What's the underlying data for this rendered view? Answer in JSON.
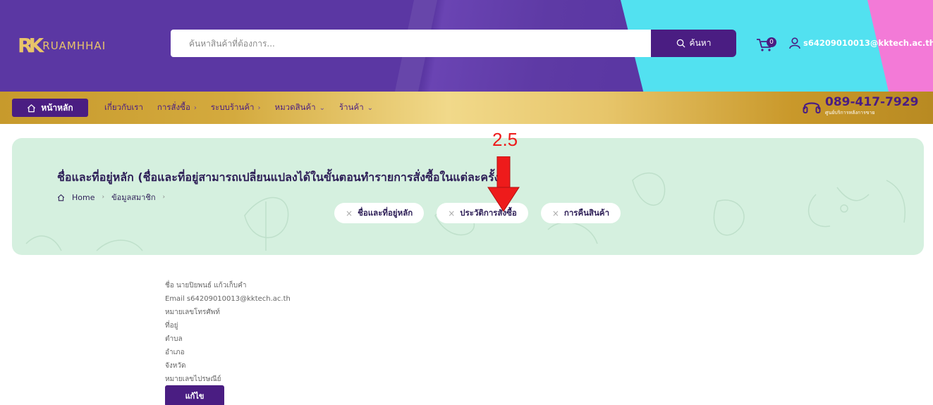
{
  "header": {
    "logo_mark": "RK",
    "logo_text": "RUAMHHAI",
    "search_placeholder": "ค้นหาสินค้าที่ต้องการ...",
    "search_button": "ค้นหา",
    "cart_count": "0",
    "user_email": "s64209010013@kktech.ac.th"
  },
  "nav": {
    "home": "หน้าหลัก",
    "items": [
      {
        "label": "เกี่ยวกับเรา",
        "chevron": ""
      },
      {
        "label": "การสั่งซื้อ",
        "chevron": "›"
      },
      {
        "label": "ระบบร้านค้า",
        "chevron": "›"
      },
      {
        "label": "หมวดสินค้า",
        "chevron": "⌄"
      },
      {
        "label": "ร้านค้า",
        "chevron": "⌄"
      }
    ],
    "hotline": "089-417-7929",
    "hotline_sub": "ศูนย์บริการหลังการขาย"
  },
  "annotation": {
    "label": "2.5"
  },
  "banner": {
    "title": "ชื่อและที่อยู่หลัก (ชื่อและที่อยู่สามารถเปลี่ยนแปลงได้ในขั้นตอนทำรายการสั่งซื้อในแต่ละครั้ง)",
    "breadcrumb": [
      "Home",
      "ข้อมูลสมาชิก"
    ],
    "chips": [
      "ชื่อและที่อยู่หลัก",
      "ประวัติการสั่งซื้อ",
      "การคืนสินค้า"
    ]
  },
  "profile": {
    "name": "ชื่อ นายปิยพนธ์ แก้วเก็บคำ",
    "email": "Email s64209010013@kktech.ac.th",
    "phone": "หมายเลขโทรศัพท์",
    "address": "ที่อยู่",
    "subdistrict": "ตำบล",
    "district": "อำเภอ",
    "province": "จังหวัด",
    "postcode": "หมายเลขไปรษณีย์",
    "edit_button": "แก้ไข"
  },
  "colors": {
    "primary": "#4a1d82",
    "header_purple": "#5b37a3",
    "gold": "#d4aa3e",
    "banner_bg": "#d5f0df",
    "annotation_red": "#ee1b1b"
  }
}
